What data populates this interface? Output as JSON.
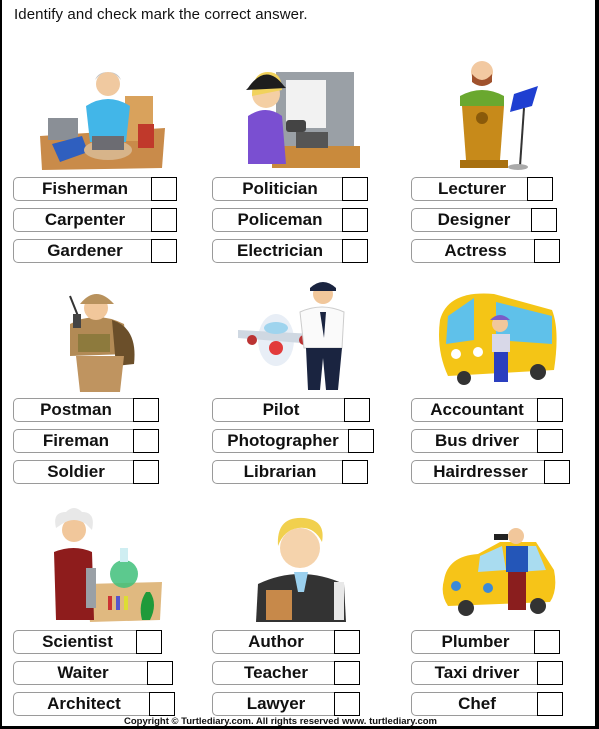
{
  "instruction": "Identify and check mark the correct answer.",
  "questions": [
    {
      "image": "carpenter-illustration",
      "options": [
        "Fisherman",
        "Carpenter",
        "Gardener"
      ]
    },
    {
      "image": "electrician-illustration",
      "options": [
        "Politician",
        "Policeman",
        "Electrician"
      ]
    },
    {
      "image": "lecturer-illustration",
      "options": [
        "Lecturer",
        "Designer",
        "Actress"
      ]
    },
    {
      "image": "soldier-illustration",
      "options": [
        "Postman",
        "Fireman",
        "Soldier"
      ]
    },
    {
      "image": "pilot-illustration",
      "options": [
        "Pilot",
        "Photographer",
        "Librarian"
      ]
    },
    {
      "image": "bus-driver-illustration",
      "options": [
        "Accountant",
        "Bus driver",
        "Hairdresser"
      ]
    },
    {
      "image": "scientist-illustration",
      "options": [
        "Scientist",
        "Waiter",
        "Architect"
      ]
    },
    {
      "image": "lawyer-illustration",
      "options": [
        "Author",
        "Teacher",
        "Lawyer"
      ]
    },
    {
      "image": "taxi-driver-illustration",
      "options": [
        "Plumber",
        "Taxi driver",
        "Chef"
      ]
    }
  ],
  "footer": {
    "copyright": "Copyright © Turtlediary.com. All rights reserved   www. turtlediary.com"
  }
}
